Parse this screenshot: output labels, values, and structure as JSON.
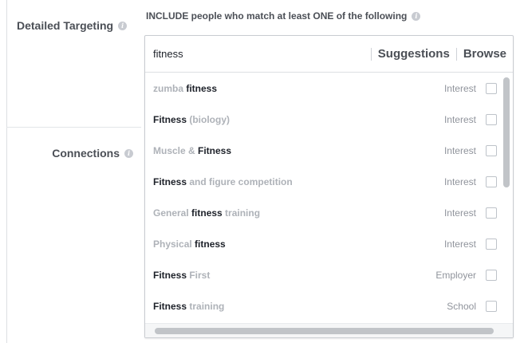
{
  "labels": {
    "detailed_targeting": "Detailed Targeting",
    "connections": "Connections",
    "include_header": "INCLUDE people who match at least ONE of the following"
  },
  "search": {
    "value": "fitness",
    "suggestions_label": "Suggestions",
    "browse_label": "Browse"
  },
  "results": [
    {
      "parts": [
        {
          "t": "zumba ",
          "m": false
        },
        {
          "t": "fitness",
          "m": true
        }
      ],
      "type": "Interest"
    },
    {
      "parts": [
        {
          "t": "Fitness",
          "m": true
        },
        {
          "t": " (biology)",
          "m": false
        }
      ],
      "type": "Interest"
    },
    {
      "parts": [
        {
          "t": "Muscle & ",
          "m": false
        },
        {
          "t": "Fitness",
          "m": true
        }
      ],
      "type": "Interest"
    },
    {
      "parts": [
        {
          "t": "Fitness",
          "m": true
        },
        {
          "t": " and figure competition",
          "m": false
        }
      ],
      "type": "Interest"
    },
    {
      "parts": [
        {
          "t": "General ",
          "m": false
        },
        {
          "t": "fitness",
          "m": true
        },
        {
          "t": " training",
          "m": false
        }
      ],
      "type": "Interest"
    },
    {
      "parts": [
        {
          "t": "Physical ",
          "m": false
        },
        {
          "t": "fitness",
          "m": true
        }
      ],
      "type": "Interest"
    },
    {
      "parts": [
        {
          "t": "Fitness",
          "m": true
        },
        {
          "t": " First",
          "m": false
        }
      ],
      "type": "Employer"
    },
    {
      "parts": [
        {
          "t": "Fitness",
          "m": true
        },
        {
          "t": " training",
          "m": false
        }
      ],
      "type": "School"
    }
  ],
  "icons": {
    "info": "info-icon",
    "checkbox": "checkbox"
  },
  "colors": {
    "match_text": "#1d2129",
    "unmatched_text": "#aeb2b8",
    "type_text": "#90949c"
  }
}
